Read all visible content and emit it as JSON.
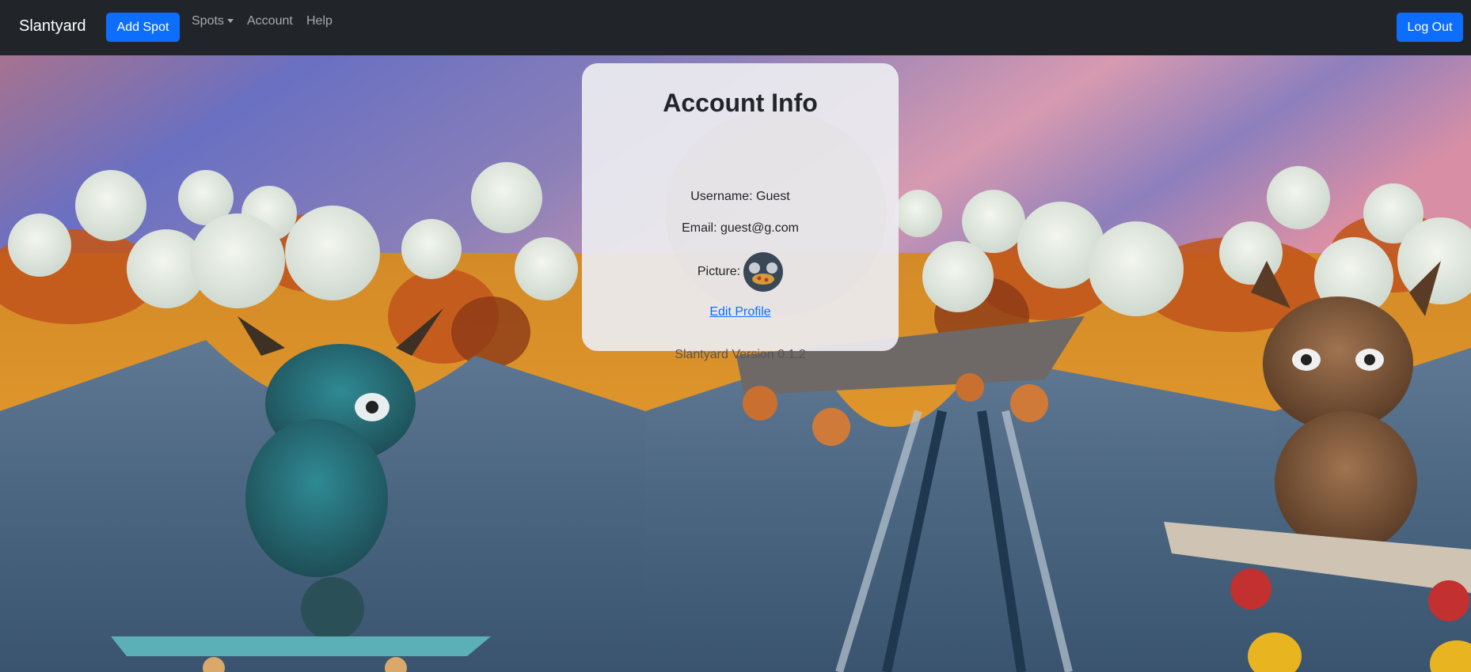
{
  "navbar": {
    "brand": "Slantyard",
    "add_spot": "Add Spot",
    "spots": "Spots",
    "account": "Account",
    "help": "Help",
    "log_out": "Log Out"
  },
  "account": {
    "title": "Account Info",
    "username": "Username: Guest",
    "email": "Email: guest@g.com",
    "picture_label": "Picture:",
    "edit_profile": "Edit Profile",
    "version": "Slantyard Version 0.1.2"
  },
  "colors": {
    "navbar_bg": "#212529",
    "primary": "#0d6efd",
    "card_bg": "#ececf0"
  }
}
